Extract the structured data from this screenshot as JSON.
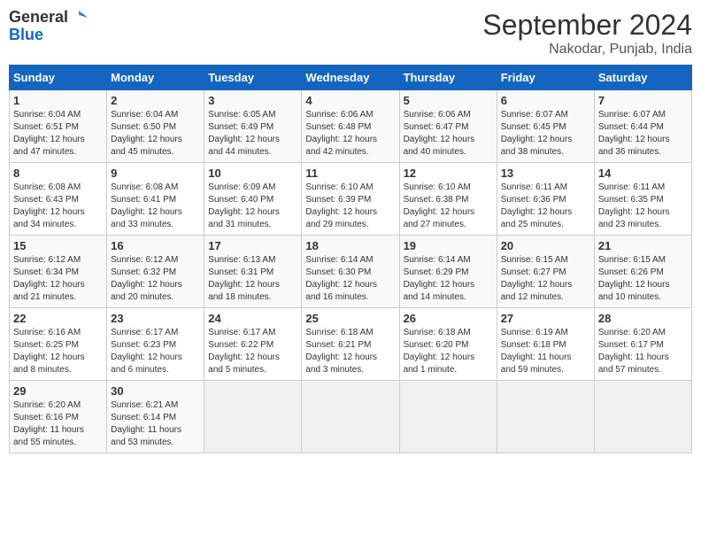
{
  "header": {
    "logo_line1": "General",
    "logo_line2": "Blue",
    "month_title": "September 2024",
    "location": "Nakodar, Punjab, India"
  },
  "weekdays": [
    "Sunday",
    "Monday",
    "Tuesday",
    "Wednesday",
    "Thursday",
    "Friday",
    "Saturday"
  ],
  "days": [
    {
      "day": "",
      "content": ""
    },
    {
      "day": "1",
      "content": "Sunrise: 6:04 AM\nSunset: 6:51 PM\nDaylight: 12 hours\nand 47 minutes."
    },
    {
      "day": "2",
      "content": "Sunrise: 6:04 AM\nSunset: 6:50 PM\nDaylight: 12 hours\nand 45 minutes."
    },
    {
      "day": "3",
      "content": "Sunrise: 6:05 AM\nSunset: 6:49 PM\nDaylight: 12 hours\nand 44 minutes."
    },
    {
      "day": "4",
      "content": "Sunrise: 6:06 AM\nSunset: 6:48 PM\nDaylight: 12 hours\nand 42 minutes."
    },
    {
      "day": "5",
      "content": "Sunrise: 6:06 AM\nSunset: 6:47 PM\nDaylight: 12 hours\nand 40 minutes."
    },
    {
      "day": "6",
      "content": "Sunrise: 6:07 AM\nSunset: 6:45 PM\nDaylight: 12 hours\nand 38 minutes."
    },
    {
      "day": "7",
      "content": "Sunrise: 6:07 AM\nSunset: 6:44 PM\nDaylight: 12 hours\nand 36 minutes."
    },
    {
      "day": "8",
      "content": "Sunrise: 6:08 AM\nSunset: 6:43 PM\nDaylight: 12 hours\nand 34 minutes."
    },
    {
      "day": "9",
      "content": "Sunrise: 6:08 AM\nSunset: 6:41 PM\nDaylight: 12 hours\nand 33 minutes."
    },
    {
      "day": "10",
      "content": "Sunrise: 6:09 AM\nSunset: 6:40 PM\nDaylight: 12 hours\nand 31 minutes."
    },
    {
      "day": "11",
      "content": "Sunrise: 6:10 AM\nSunset: 6:39 PM\nDaylight: 12 hours\nand 29 minutes."
    },
    {
      "day": "12",
      "content": "Sunrise: 6:10 AM\nSunset: 6:38 PM\nDaylight: 12 hours\nand 27 minutes."
    },
    {
      "day": "13",
      "content": "Sunrise: 6:11 AM\nSunset: 6:36 PM\nDaylight: 12 hours\nand 25 minutes."
    },
    {
      "day": "14",
      "content": "Sunrise: 6:11 AM\nSunset: 6:35 PM\nDaylight: 12 hours\nand 23 minutes."
    },
    {
      "day": "15",
      "content": "Sunrise: 6:12 AM\nSunset: 6:34 PM\nDaylight: 12 hours\nand 21 minutes."
    },
    {
      "day": "16",
      "content": "Sunrise: 6:12 AM\nSunset: 6:32 PM\nDaylight: 12 hours\nand 20 minutes."
    },
    {
      "day": "17",
      "content": "Sunrise: 6:13 AM\nSunset: 6:31 PM\nDaylight: 12 hours\nand 18 minutes."
    },
    {
      "day": "18",
      "content": "Sunrise: 6:14 AM\nSunset: 6:30 PM\nDaylight: 12 hours\nand 16 minutes."
    },
    {
      "day": "19",
      "content": "Sunrise: 6:14 AM\nSunset: 6:29 PM\nDaylight: 12 hours\nand 14 minutes."
    },
    {
      "day": "20",
      "content": "Sunrise: 6:15 AM\nSunset: 6:27 PM\nDaylight: 12 hours\nand 12 minutes."
    },
    {
      "day": "21",
      "content": "Sunrise: 6:15 AM\nSunset: 6:26 PM\nDaylight: 12 hours\nand 10 minutes."
    },
    {
      "day": "22",
      "content": "Sunrise: 6:16 AM\nSunset: 6:25 PM\nDaylight: 12 hours\nand 8 minutes."
    },
    {
      "day": "23",
      "content": "Sunrise: 6:17 AM\nSunset: 6:23 PM\nDaylight: 12 hours\nand 6 minutes."
    },
    {
      "day": "24",
      "content": "Sunrise: 6:17 AM\nSunset: 6:22 PM\nDaylight: 12 hours\nand 5 minutes."
    },
    {
      "day": "25",
      "content": "Sunrise: 6:18 AM\nSunset: 6:21 PM\nDaylight: 12 hours\nand 3 minutes."
    },
    {
      "day": "26",
      "content": "Sunrise: 6:18 AM\nSunset: 6:20 PM\nDaylight: 12 hours\nand 1 minute."
    },
    {
      "day": "27",
      "content": "Sunrise: 6:19 AM\nSunset: 6:18 PM\nDaylight: 11 hours\nand 59 minutes."
    },
    {
      "day": "28",
      "content": "Sunrise: 6:20 AM\nSunset: 6:17 PM\nDaylight: 11 hours\nand 57 minutes."
    },
    {
      "day": "29",
      "content": "Sunrise: 6:20 AM\nSunset: 6:16 PM\nDaylight: 11 hours\nand 55 minutes."
    },
    {
      "day": "30",
      "content": "Sunrise: 6:21 AM\nSunset: 6:14 PM\nDaylight: 11 hours\nand 53 minutes."
    },
    {
      "day": "",
      "content": ""
    },
    {
      "day": "",
      "content": ""
    },
    {
      "day": "",
      "content": ""
    },
    {
      "day": "",
      "content": ""
    }
  ]
}
